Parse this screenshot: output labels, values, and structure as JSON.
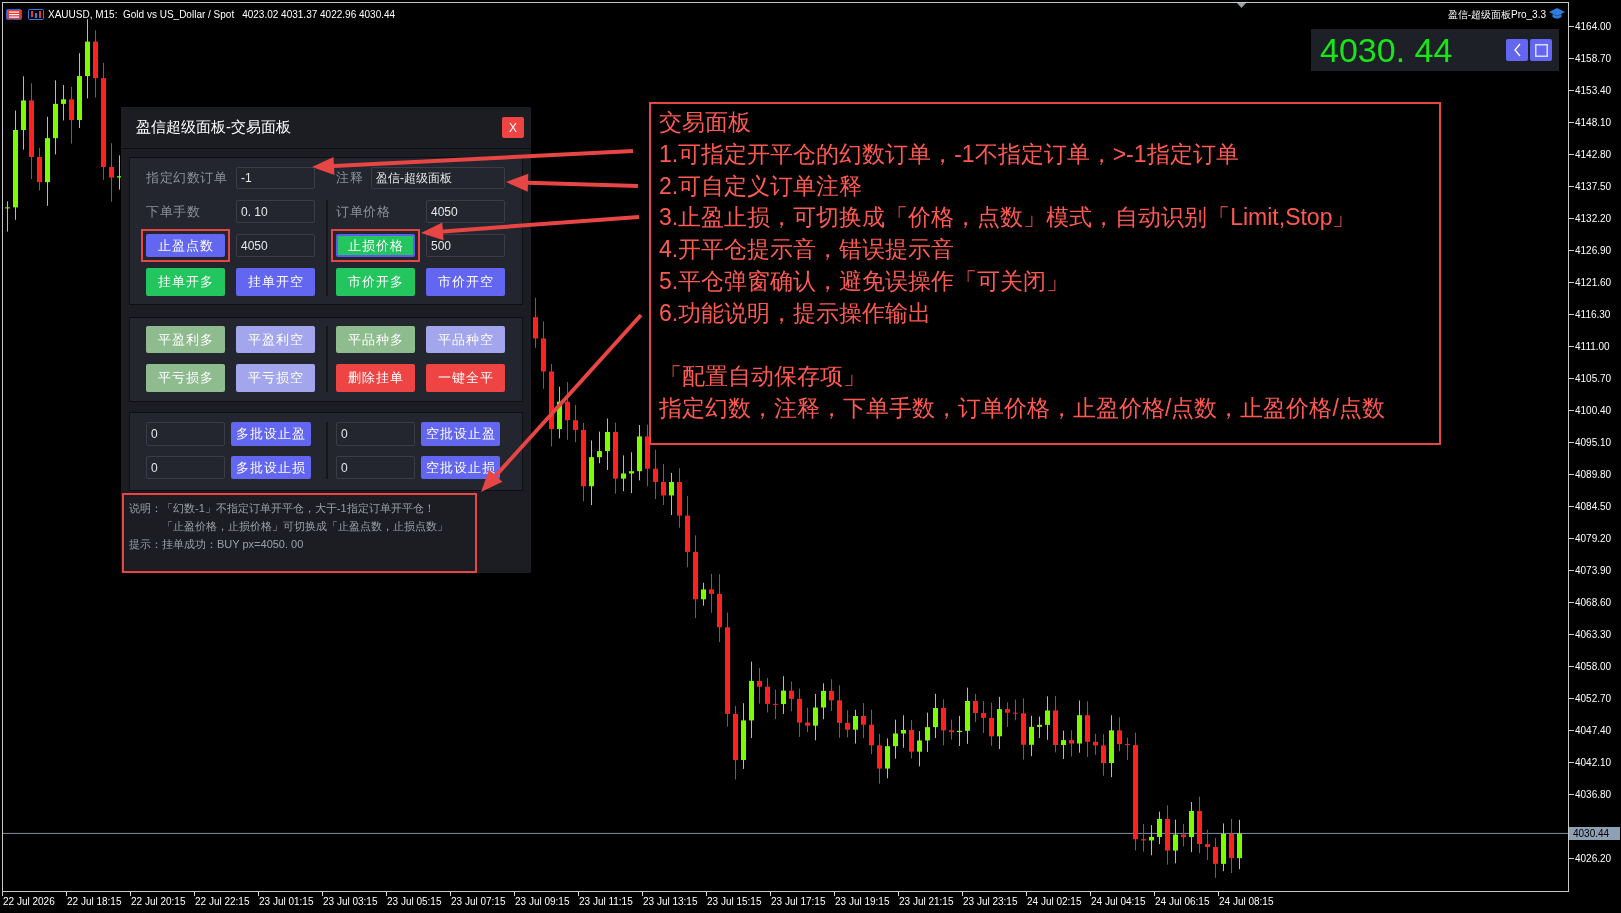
{
  "chart": {
    "title": "XAUUSD, M15:  Gold vs US_Dollar / Spot",
    "quote": "4023.02 4031.37 4022.96 4030.44",
    "indicator_label": "盈信-超级面板Pro_3.3",
    "price_display": "4030. 44",
    "price_axis": {
      "labels_above": [
        "4164.00",
        "4158.70",
        "4153.40",
        "4148.10",
        "4142.80",
        "4137.50",
        "4132.20",
        "4126.90",
        "4121.60",
        "4116.30",
        "4111.00",
        "4105.70",
        "4100.40",
        "4095.10",
        "4089.80",
        "4084.50",
        "4079.20",
        "4073.90",
        "4068.60",
        "4063.30",
        "4058.00",
        "4052.70",
        "4047.40",
        "4042.10",
        "4036.80"
      ],
      "current_price": "4030.44",
      "labels_below": [
        "4026.20"
      ]
    },
    "time_axis": [
      "22 Jul 2026",
      "22 Jul 18:15",
      "22 Jul 20:15",
      "22 Jul 22:15",
      "23 Jul 01:15",
      "23 Jul 03:15",
      "23 Jul 05:15",
      "23 Jul 07:15",
      "23 Jul 09:15",
      "23 Jul 11:15",
      "23 Jul 13:15",
      "23 Jul 15:15",
      "23 Jul 17:15",
      "23 Jul 19:15",
      "23 Jul 21:15",
      "23 Jul 23:15",
      "24 Jul 02:15",
      "24 Jul 04:15",
      "24 Jul 06:15",
      "24 Jul 08:15"
    ]
  },
  "panel": {
    "title": "盈信超级面板-交易面板",
    "close_button": "X",
    "settings": {
      "magic_label": "指定幻数订单",
      "magic_value": "-1",
      "comment_label": "注释",
      "comment_value": "盈信-超级面板",
      "lots_label": "下单手数",
      "lots_value": "0. 10",
      "price_label": "订单价格",
      "price_value": "4050",
      "take_profit": {
        "label": "止盈点数",
        "kind": "points",
        "value": "4050"
      },
      "stop_loss": {
        "label": "止损价格",
        "kind": "price",
        "value": "500"
      }
    },
    "order_buttons": [
      {
        "label": "挂单开多",
        "kind": "long"
      },
      {
        "label": "挂单开空",
        "kind": "short"
      },
      {
        "label": "市价开多",
        "kind": "long"
      },
      {
        "label": "市价开空",
        "kind": "short"
      }
    ],
    "close_buttons": [
      {
        "label": "平盈利多",
        "kind": "close_long"
      },
      {
        "label": "平盈利空",
        "kind": "close_short"
      },
      {
        "label": "平品种多",
        "kind": "close_long"
      },
      {
        "label": "平品种空",
        "kind": "close_short"
      },
      {
        "label": "平亏损多",
        "kind": "close_long"
      },
      {
        "label": "平亏损空",
        "kind": "close_short"
      },
      {
        "label": "删除挂单",
        "kind": "danger"
      },
      {
        "label": "一键全平",
        "kind": "danger"
      }
    ],
    "batch_rows": [
      {
        "long_value": "0",
        "long_button": "多批设止盈",
        "short_value": "0",
        "short_button": "空批设止盈"
      },
      {
        "long_value": "0",
        "long_button": "多批设止损",
        "short_value": "0",
        "short_button": "空批设止损"
      }
    ],
    "notes": {
      "label": "说明：",
      "lines": [
        "「幻数-1」不指定订单开平仓，大于-1指定订单开平仓！",
        "「止盈价格，止损价格」可切换成「止盈点数，止损点数」"
      ]
    },
    "hint": "提示：挂单成功：BUY px=4050. 00"
  },
  "annotation": {
    "title": "交易面板",
    "items": [
      "1.可指定开平仓的幻数订单，-1不指定订单，>-1指定订单",
      "2.可自定义订单注释",
      "3.止盈止损，可切换成「价格，点数」模式，自动识别「Limit,Stop」",
      "4.开平仓提示音，错误提示音",
      "5.平仓弹窗确认，避免误操作「可关闭」",
      "6.功能说明，提示操作输出"
    ],
    "section_title": "「配置自动保存项」",
    "section_text": "指定幻数，注释，下单手数，订单价格，止盈价格/点数，止盈价格/点数"
  }
}
